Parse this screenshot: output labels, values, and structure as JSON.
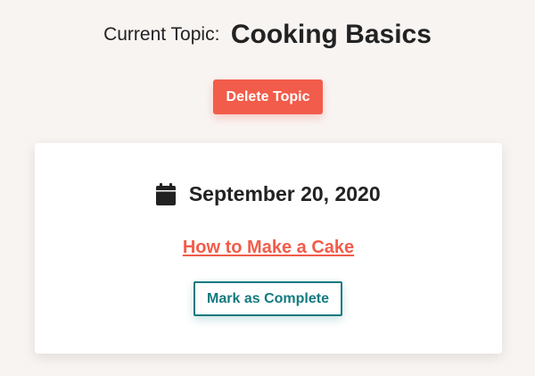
{
  "header": {
    "prefix": "Current Topic:",
    "topic_name": "Cooking Basics"
  },
  "actions": {
    "delete_label": "Delete Topic"
  },
  "lesson_card": {
    "date_icon": "calendar-icon",
    "date": "September 20, 2020",
    "lesson_title": "How to Make a Cake",
    "complete_label": "Mark as Complete"
  },
  "colors": {
    "background": "#f8f4f2",
    "accent": "#f25c4a",
    "teal": "#137a7f",
    "text": "#222222",
    "card": "#ffffff"
  }
}
